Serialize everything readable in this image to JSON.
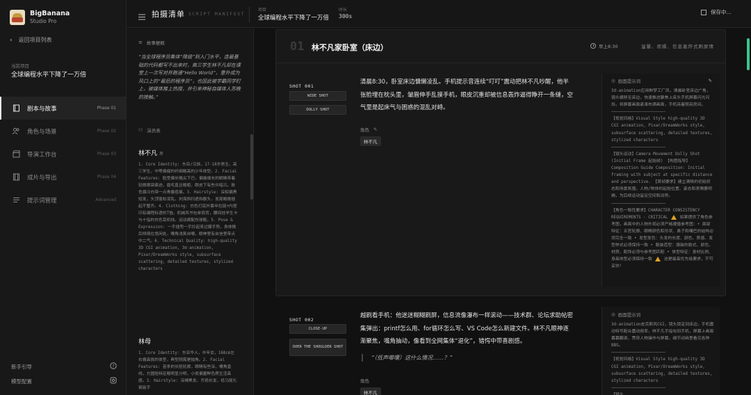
{
  "brand": {
    "name": "BigBanana",
    "subtitle": "Studio Pro"
  },
  "back_link": "返回项目列表",
  "project": {
    "label": "当前项目",
    "name": "全球编程水平下降了一万倍"
  },
  "nav": [
    {
      "label": "剧本与故事",
      "phase": "Phase 01",
      "icon": "book-icon",
      "active": true
    },
    {
      "label": "角色与场景",
      "phase": "Phase 02",
      "icon": "users-icon",
      "active": false
    },
    {
      "label": "导演工作台",
      "phase": "Phase 03",
      "icon": "clapperboard-icon",
      "active": false
    },
    {
      "label": "成片与导出",
      "phase": "Phase 04",
      "icon": "film-icon",
      "active": false
    },
    {
      "label": "提示词管理",
      "phase": "Advanced",
      "icon": "list-icon",
      "active": false
    }
  ],
  "footer": {
    "guide": "新手引导",
    "model_config": "模型配置"
  },
  "header": {
    "title": "拍摄清单",
    "subtitle": "SCRIPT MANIFEST",
    "project_label": "项目",
    "project_value": "全球编程水平下降了一万倍",
    "duration_label": "时长",
    "duration_value": "300s",
    "save_status": "保存中..."
  },
  "script_panel": {
    "synopsis_title": "故事梗概",
    "synopsis": "“当全球程序员集体“降级”到入门水平，连最基础的代码都写不出来时，高三学生林不凡却在课堂上一次写对并跑通“Hello World”，意外成为风口上的“最后的程序员”，也因此被学霸同学盯上，被媒体推上热搜，并引来神秘自媒体人苏晚的接触。”",
    "cast_title": "演员表",
    "characters": [
      {
        "name": "林不凡",
        "tag": "男",
        "desc": "1. Core Identity: 东亚/汉族，17-18岁男生，高三学生，中等偏瘦的纤细略高的少年体型。2. Facial Features: 脸型偏长略尖下巴，偏瘦细长的眼睛带着轻微眼袋痕迹，眉毛直且略粗，眼皮下有些许暗沉，肤色偏冷白带一点青春痘痕。3. Hairstyle: 深棕偏黑短发，头顶蓬松凌乱，刘海斜扫遮挡额头，发尾略微翘起不整齐。4. Clothing: 白色打底外套半拉链+内搭印有编程标语的T恤，机械风书包单肩背，腰间挂学生卡与十指的白色耳机线。运动裤配白球鞋。5. Pose & Expression: 一手插兜一手拎起来过瓣手势，身体微后倾倚在悠闲处，嘴角浅笑自嘲，眼神里有自信里带点中二气。6. Technical Quality: high-quality 3D CGI animation, 3d-animation, Pixar/DreamWorks style, subsurface scattering, detailed textures, stylized characters"
      },
      {
        "name": "林母",
        "tag": "",
        "desc": "1. Core Identity: 东亚华人，中年女，168cm左右偏高挑的体型，典型刚需是独角。2. Facial Features: 苗条的长脸轮廓，眼睛有些深，嘴角直线，方圆脸特征略明显分明，小类偏量鲜色质生活高感。3. Hairstyle: 深褐黑发，齐肩长发，低马尾扎紧能手"
      }
    ]
  },
  "scene": {
    "number": "01",
    "title": "林不凡家卧室（床边）",
    "time": "早上8:30",
    "style": "温馨、烦躁、信息轰炸式刷屏情"
  },
  "shots": [
    {
      "label": "SHOT 001",
      "chips": [
        "WIDE SHOT",
        "DOLLY SHOT"
      ],
      "action": "清晨8:30，卧室床边慵懒凌乱。手机提示音连续“叮叮”震动把林不凡吵醒，他半张脸埋在枕头里，皱眉伸手乱摸手机，眼皮沉重却被信息轰炸逼得睁开一条缝，空气里是起床气与困惑的混乱对峙。",
      "quote": "",
      "role_label": "角色",
      "role": "林不凡",
      "prompt_title": "画面提示词",
      "prompt": "3d-animation应用鲜梦工厂风，清晨卧室床边广角，镜头横移至床边，快速推进聚焦上床头手机屏幕闪光闪烁，将屏幕画面紧凑布满画面，手机亮着照亮房间。\n——————————————————————\n【视觉风格】Visual Style high-quality 3D CGI animation, Pixar/DreamWorks style, subsurface scattering, detailed textures, stylized characters\n——————————————————————\n【镜头运动】Camera Movement Dolly Shot (Initial Frame 起始帧) 【构图指导】Composition Guide Composition: Initial framing with subject at specific distance and perspective. 【首帧要求】建立清晰的初始状态和场景氛围，人物/物体的起始位置、姿态和表情要明确，为后续运动留足空间和动势。\n——————————————————————\n【角色一致性要求】CHARACTER CONSISTENCY REQUIREMENTS - CRITICAL ⚠ 如果提供了角色参考图，画面中的人物外观必须严格遵循参考图：• 面部特征：五官轮廓、眼睛颜色和形状、鼻子和嘴巴的结构必须完全一致 • 发型发色：头发的长度、颜色、质感、发型样式必须保持一致 • 服装造型：服装的款式、颜色、材质、配饰必须与参考图匹配 • 体型特征：身材比例、身高体型必须保持一致 ⚠ 这是最高优先级要求，不可妥协！"
    },
    {
      "label": "SHOT 002",
      "chips": [
        "CLOSE-UP",
        "OVER THE SHOULDER SHOT"
      ],
      "action": "越刷看手机：他迷迷糊糊刷屏，信息流像瀑布一样滚动——技术群、论坛求助帖密集弹出：printf怎么用、for循环怎么写、VS Code怎么新建文件。林不凡眼神逐渐聚焦，嘴角抽动，像看到全网集体“退化”，错愕中带喜剧感。",
      "quote": "“（低声嘟囔）这什么情况……？”",
      "role_label": "角色",
      "role": "林不凡",
      "prompt_title": "画面提示词",
      "prompt": "3d-animation皮克斯风CGI，镜头锁定到床边，手机震动特写配合震动频率，林不凡手指勾到手机，屏幕上画面幕幕翻滚，贯穿人物操作与屏幕，细节动画里看见各种BBS。\n——————————————————————\n【视觉风格】Visual Style high-quality 3D CGI animation, Pixar/DreamWorks style, subsurface scattering, detailed textures, stylized characters\n——————————————————————\n【镜头"
    }
  ]
}
